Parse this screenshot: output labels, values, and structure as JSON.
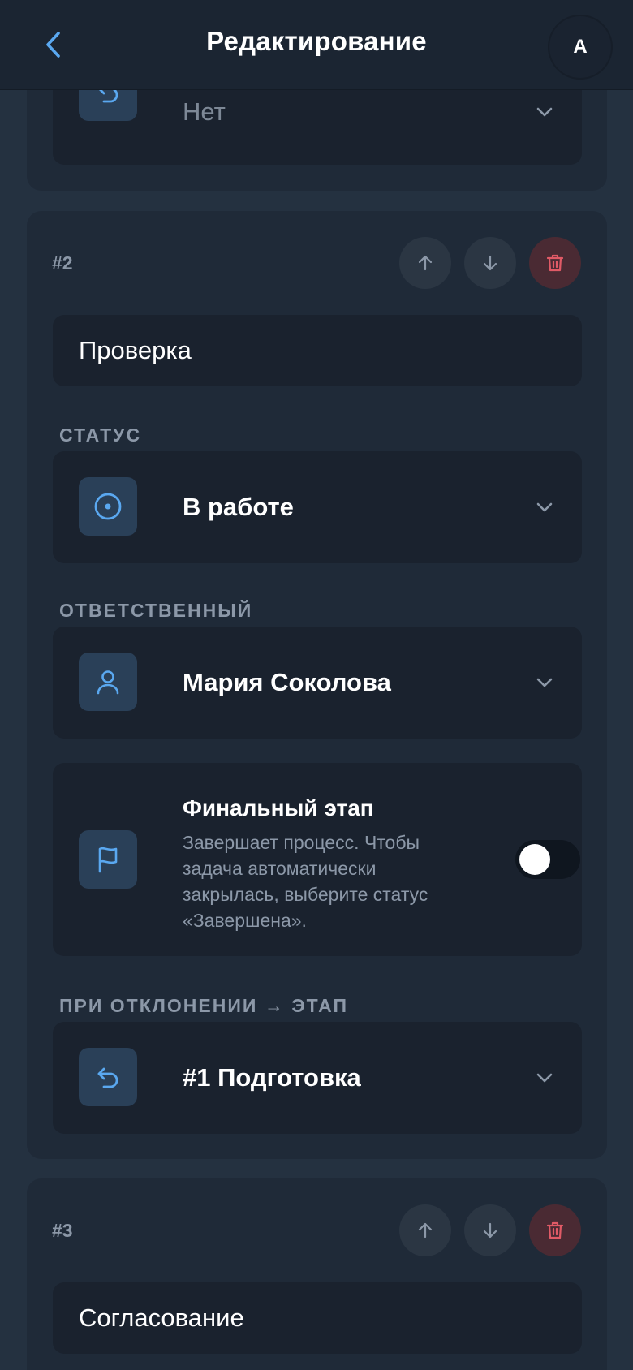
{
  "header": {
    "title": "Редактирование",
    "avatar_initial": "А"
  },
  "step1": {
    "reject_value": "Нет"
  },
  "step2": {
    "number": "#2",
    "name": "Проверка",
    "status_label": "СТАТУС",
    "status_value": "В работе",
    "assignee_label": "ОТВЕТСТВЕННЫЙ",
    "assignee_value": "Мария Соколова",
    "final_title": "Финальный этап",
    "final_desc": "Завершает процесс. Чтобы задача автоматически закрылась, выберите статус «Завершена».",
    "final_enabled": false,
    "reject_label": "ПРИ ОТКЛОНЕНИИ → ЭТАП",
    "reject_value": "#1 Подготовка"
  },
  "step3": {
    "number": "#3",
    "name": "Согласование"
  },
  "colors": {
    "accent": "#5aa8f0",
    "danger": "#e05a66",
    "background": "#243140",
    "card": "#1f2a38"
  },
  "icons": {
    "back": "chevron-left-icon",
    "reject": "undo-icon",
    "status": "target-icon",
    "assignee": "user-icon",
    "final": "flag-icon",
    "up": "arrow-up-icon",
    "down": "arrow-down-icon",
    "delete": "trash-icon",
    "dropdown": "chevron-down-icon"
  }
}
